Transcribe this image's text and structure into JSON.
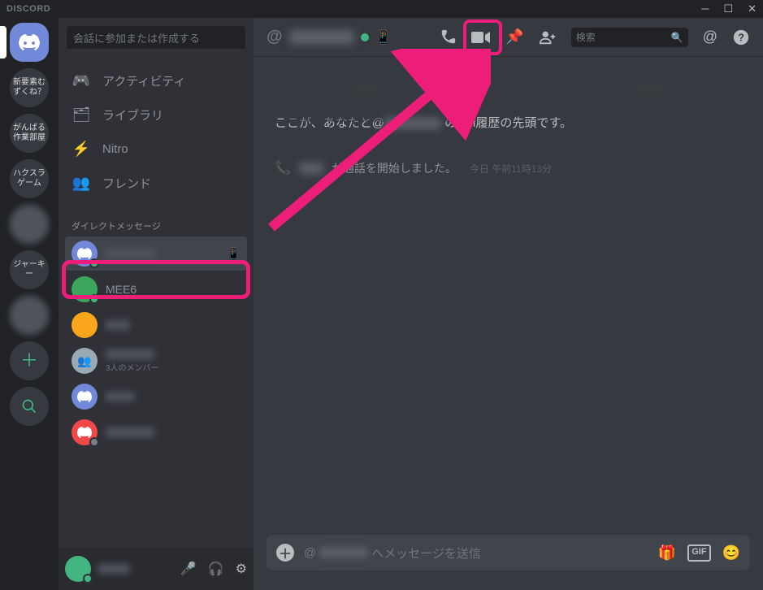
{
  "titlebar": {
    "brand": "DISCORD"
  },
  "guilds": {
    "items": [
      {
        "label": "新要素むずくね？"
      },
      {
        "label": "がんばる作業部屋"
      },
      {
        "label": "ハクスラゲーム"
      },
      {
        "label": ""
      },
      {
        "label": "ジャーキー"
      },
      {
        "label": ""
      }
    ]
  },
  "privateChannels": {
    "searchPlaceholder": "会話に参加または作成する",
    "nav": [
      {
        "label": "アクティビティ"
      },
      {
        "label": "ライブラリ"
      },
      {
        "label": "Nitro"
      },
      {
        "label": "フレンド"
      }
    ],
    "dmHeader": "ダイレクトメッセージ",
    "dms": [
      {
        "name": "",
        "selected": true,
        "mobile": true
      },
      {
        "name": "MEE6"
      },
      {
        "name": ""
      },
      {
        "name": "",
        "sub": "3人のメンバー"
      },
      {
        "name": ""
      },
      {
        "name": ""
      }
    ]
  },
  "userArea": {
    "name": ""
  },
  "chat": {
    "header": {
      "at": "@",
      "searchPlaceholder": "検索"
    },
    "start": {
      "prefix": "ここが、あなたと@",
      "suffix": "のDM履歴の先頭です。"
    },
    "call": {
      "text": "が通話を開始しました。",
      "time": "今日 午前11時13分"
    },
    "composer": {
      "prefix": "@",
      "suffix": "へメッセージを送信",
      "gif": "GIF"
    }
  }
}
